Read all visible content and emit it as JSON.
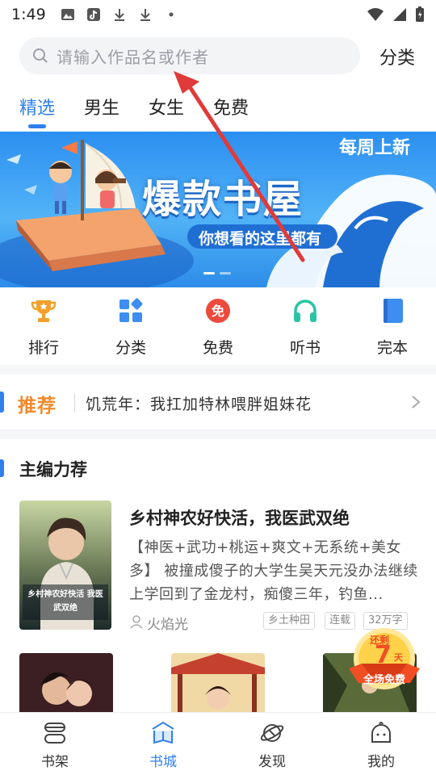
{
  "status_bar": {
    "time": "1:49"
  },
  "search": {
    "placeholder": "请输入作品名或作者",
    "category_label": "分类"
  },
  "tabs": [
    {
      "label": "精选",
      "active": true
    },
    {
      "label": "男生",
      "active": false
    },
    {
      "label": "女生",
      "active": false
    },
    {
      "label": "免费",
      "active": false
    }
  ],
  "banner": {
    "title": "爆款书屋",
    "badge": "每周上新",
    "subtitle": "你想看的这里都有",
    "page_count": 2,
    "active_page": 1
  },
  "quick_nav": [
    {
      "label": "排行",
      "icon": "trophy-icon",
      "color": "#f2a02b"
    },
    {
      "label": "分类",
      "icon": "category-grid-icon",
      "color": "#3d8ef0"
    },
    {
      "label": "免费",
      "icon": "free-icon",
      "color": "#ee4a3c"
    },
    {
      "label": "听书",
      "icon": "headphones-icon",
      "color": "#2bc3a5"
    },
    {
      "label": "完本",
      "icon": "book-icon",
      "color": "#3d8ef0"
    }
  ],
  "recommend": {
    "title": "推荐",
    "text": "饥荒年：我扛加特林喂胖姐妹花"
  },
  "editor_section": {
    "title": "主编力荐",
    "book": {
      "title": "乡村神农好快活，我医武双绝",
      "description": "【神医+武功+桃运+爽文+无系统+美女多】 被撞成傻子的大学生吴天元没办法继续上学回到了金龙村，痴傻三年，钓鱼...",
      "author": "火焰光",
      "tags": [
        "乡土种田",
        "连载",
        "32万字"
      ],
      "cover_text": "乡村神农好快活 我医武双绝"
    }
  },
  "promo": {
    "top": "还剩",
    "number": "7",
    "unit": "天",
    "bottom": "全场免费"
  },
  "bottom_nav": [
    {
      "label": "书架",
      "icon": "bookshelf-icon",
      "active": false
    },
    {
      "label": "书城",
      "icon": "bookstore-icon",
      "active": true
    },
    {
      "label": "发现",
      "icon": "planet-icon",
      "active": false
    },
    {
      "label": "我的",
      "icon": "profile-icon",
      "active": false
    }
  ],
  "colors": {
    "accent": "#2f80ed",
    "recommend_title": "#f08a2c",
    "annotation_arrow": "#e03a3a"
  }
}
